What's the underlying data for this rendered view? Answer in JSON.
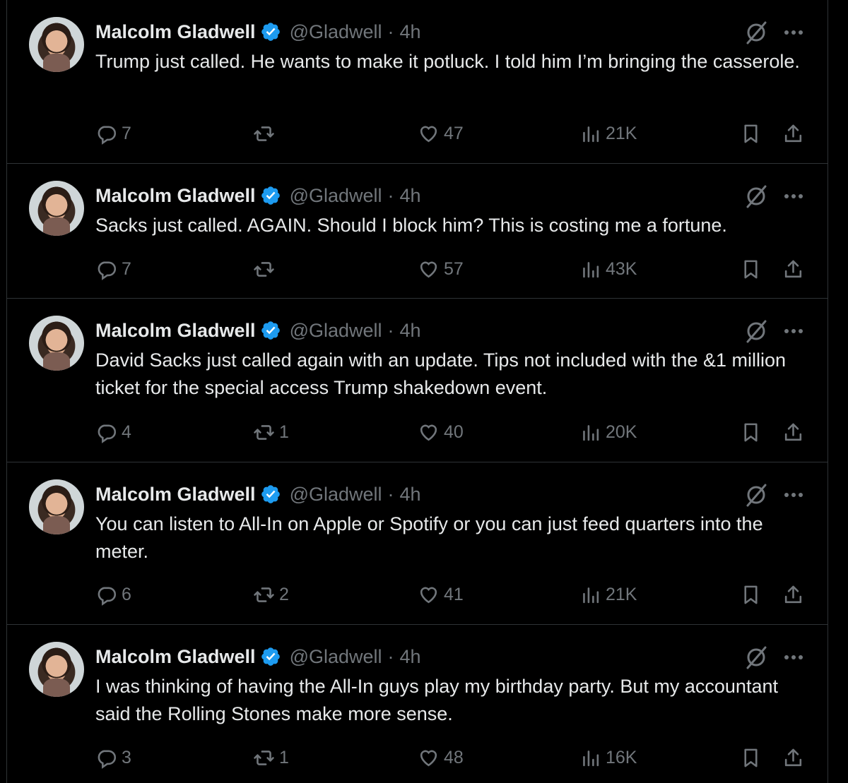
{
  "colors": {
    "background": "#000000",
    "text": "#e7e9ea",
    "muted": "#71767b",
    "verified_blue": "#1d9bf0",
    "border": "#2f3336"
  },
  "tweets": [
    {
      "name": "Malcolm Gladwell",
      "handle": "@Gladwell",
      "separator": "·",
      "time": "4h",
      "text": "Trump just called. He wants to make it potluck. I told him I’m bringing the casserole.",
      "replies": "7",
      "retweets": "",
      "likes": "47",
      "views": "21K"
    },
    {
      "name": "Malcolm Gladwell",
      "handle": "@Gladwell",
      "separator": "·",
      "time": "4h",
      "text": "Sacks just called. AGAIN. Should I block him? This is costing me a fortune.",
      "replies": "7",
      "retweets": "",
      "likes": "57",
      "views": "43K"
    },
    {
      "name": "Malcolm Gladwell",
      "handle": "@Gladwell",
      "separator": "·",
      "time": "4h",
      "text": "David Sacks just called again with an update. Tips not included with the &1 million ticket for the special access Trump shakedown event.",
      "replies": "4",
      "retweets": "1",
      "likes": "40",
      "views": "20K"
    },
    {
      "name": "Malcolm Gladwell",
      "handle": "@Gladwell",
      "separator": "·",
      "time": "4h",
      "text": "You can listen to All-In on Apple or Spotify or you can just feed quarters into the meter.",
      "replies": "6",
      "retweets": "2",
      "likes": "41",
      "views": "21K"
    },
    {
      "name": "Malcolm Gladwell",
      "handle": "@Gladwell",
      "separator": "·",
      "time": "4h",
      "text": "I was thinking of having the All-In guys play my birthday party. But my accountant said the Rolling Stones make more sense.",
      "replies": "3",
      "retweets": "1",
      "likes": "48",
      "views": "16K"
    }
  ]
}
